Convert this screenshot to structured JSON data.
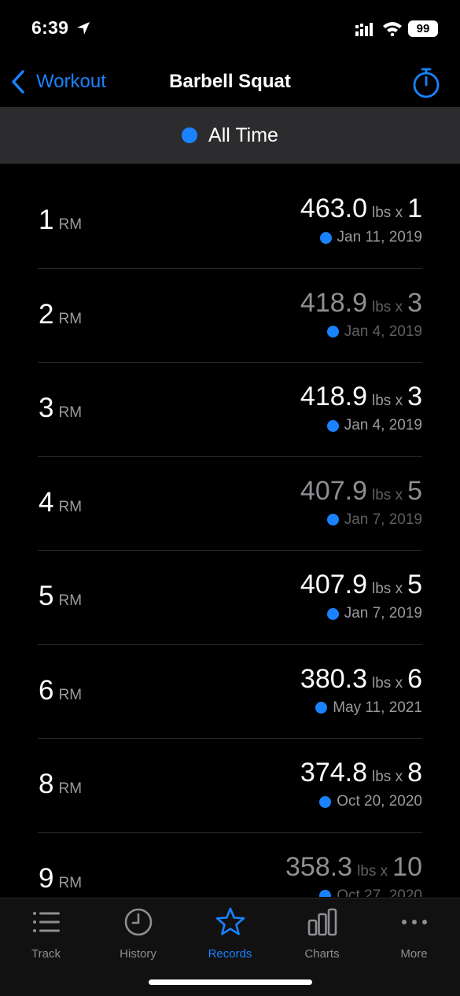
{
  "status_bar": {
    "time": "6:39",
    "battery": "99"
  },
  "nav": {
    "back_label": "Workout",
    "title": "Barbell Squat"
  },
  "filter": {
    "label": "All Time"
  },
  "records": [
    {
      "rm": "1",
      "unit": "RM",
      "weight": "463.0",
      "lbs": "lbs x",
      "reps": "1",
      "date": "Jan 11, 2019",
      "dim": false
    },
    {
      "rm": "2",
      "unit": "RM",
      "weight": "418.9",
      "lbs": "lbs x",
      "reps": "3",
      "date": "Jan 4, 2019",
      "dim": true
    },
    {
      "rm": "3",
      "unit": "RM",
      "weight": "418.9",
      "lbs": "lbs x",
      "reps": "3",
      "date": "Jan 4, 2019",
      "dim": false
    },
    {
      "rm": "4",
      "unit": "RM",
      "weight": "407.9",
      "lbs": "lbs x",
      "reps": "5",
      "date": "Jan 7, 2019",
      "dim": true
    },
    {
      "rm": "5",
      "unit": "RM",
      "weight": "407.9",
      "lbs": "lbs x",
      "reps": "5",
      "date": "Jan 7, 2019",
      "dim": false
    },
    {
      "rm": "6",
      "unit": "RM",
      "weight": "380.3",
      "lbs": "lbs x",
      "reps": "6",
      "date": "May 11, 2021",
      "dim": false
    },
    {
      "rm": "8",
      "unit": "RM",
      "weight": "374.8",
      "lbs": "lbs x",
      "reps": "8",
      "date": "Oct 20, 2020",
      "dim": false
    },
    {
      "rm": "9",
      "unit": "RM",
      "weight": "358.3",
      "lbs": "lbs x",
      "reps": "10",
      "date": "Oct 27, 2020",
      "dim": true
    }
  ],
  "tabs": [
    {
      "label": "Track",
      "icon": "list-icon",
      "active": false
    },
    {
      "label": "History",
      "icon": "clock-icon",
      "active": false
    },
    {
      "label": "Records",
      "icon": "star-icon",
      "active": true
    },
    {
      "label": "Charts",
      "icon": "bar-chart-icon",
      "active": false
    },
    {
      "label": "More",
      "icon": "ellipsis-icon",
      "active": false
    }
  ],
  "colors": {
    "accent": "#1a82ff",
    "background": "#000000",
    "filter_bar": "#2c2c2e",
    "secondary_text": "#9a9a9e"
  }
}
